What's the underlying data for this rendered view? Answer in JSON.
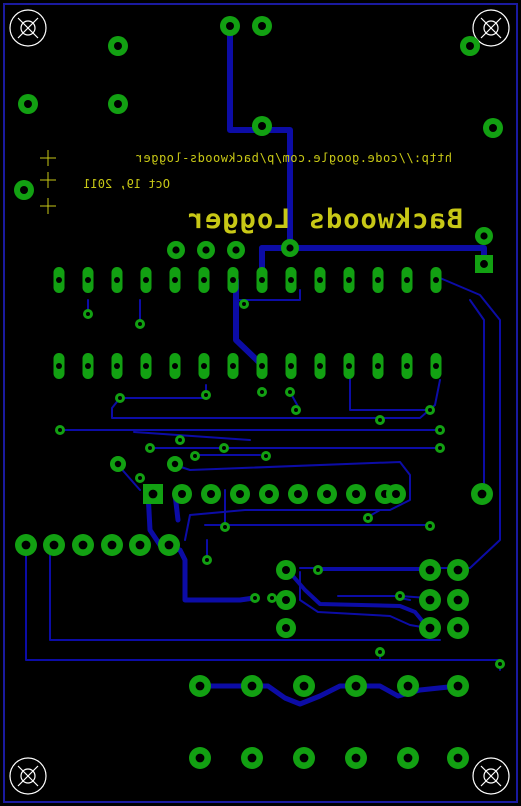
{
  "colors": {
    "background": "#000000",
    "board_outline": "#1a1aa0",
    "trace": "#0c0ca6",
    "pad": "#12a012",
    "drill": "#000000",
    "silkscreen": "#c8c816",
    "mounting_hole": "#ffffff"
  },
  "silkscreen": {
    "url": "http://code.google.com/p/backwoods-logger",
    "date": "Oct 19, 2011",
    "title": "Backwoods Logger"
  },
  "mounting_holes": 4
}
